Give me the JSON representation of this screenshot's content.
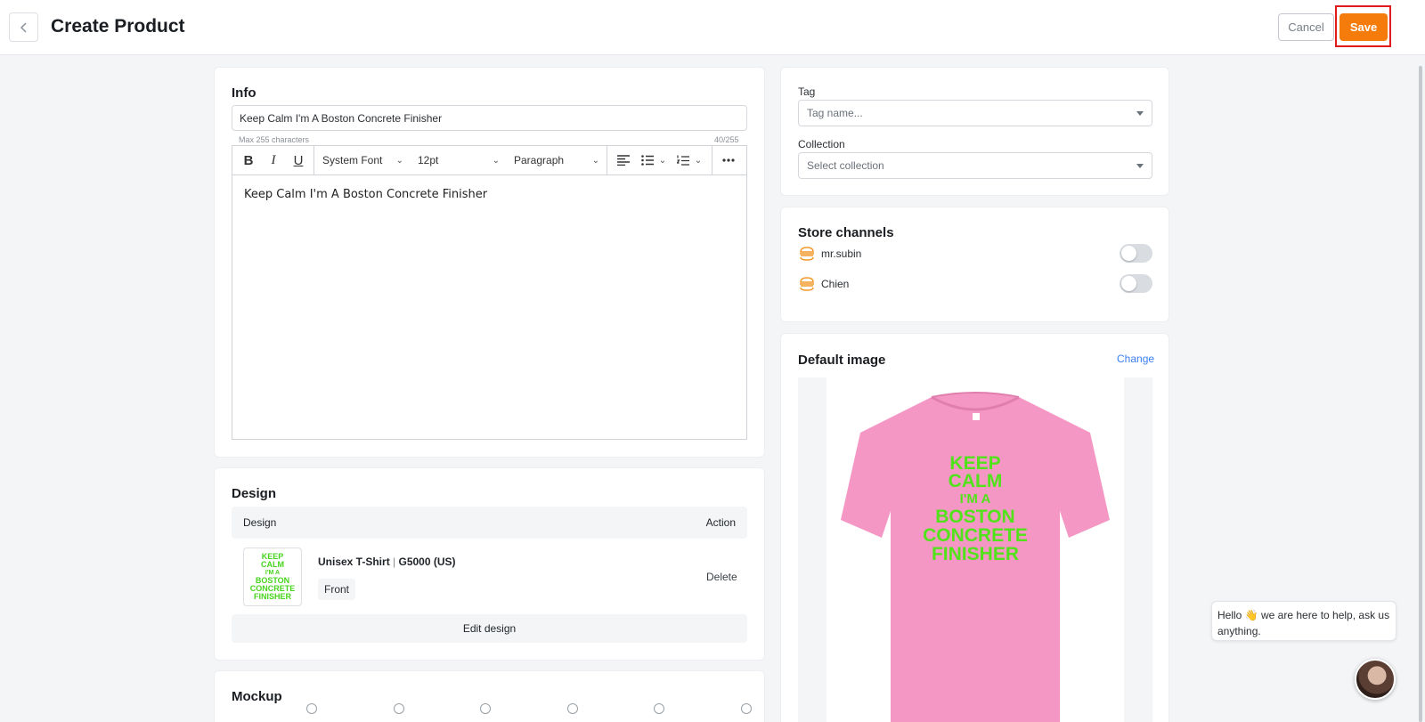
{
  "header": {
    "title": "Create Product",
    "cancel_label": "Cancel",
    "save_label": "Save"
  },
  "info": {
    "title": "Info",
    "product_name": "Keep Calm I'm A Boston Concrete Finisher",
    "max_note": "Max 255 characters",
    "char_count": "40/255",
    "toolbar": {
      "bold": "B",
      "italic": "I",
      "underline": "U",
      "font": "System Font",
      "size": "12pt",
      "block": "Paragraph"
    },
    "description": "Keep Calm I'm A Boston Concrete Finisher"
  },
  "design": {
    "title": "Design",
    "col_design": "Design",
    "col_action": "Action",
    "thumb_lines": [
      "KEEP",
      "CALM",
      "I'M A",
      "BOSTON",
      "CONCRETE",
      "FINISHER"
    ],
    "product_name": "Unisex T-Shirt",
    "product_sep": " | ",
    "product_code": "G5000 (US)",
    "side": "Front",
    "delete_label": "Delete",
    "edit_label": "Edit design"
  },
  "mockup": {
    "title": "Mockup"
  },
  "tag": {
    "label": "Tag",
    "placeholder": "Tag name..."
  },
  "collection": {
    "label": "Collection",
    "placeholder": "Select collection"
  },
  "store_channels": {
    "title": "Store channels",
    "items": [
      {
        "name": "mr.subin",
        "enabled": false
      },
      {
        "name": "Chien",
        "enabled": false
      }
    ]
  },
  "default_image": {
    "title": "Default image",
    "change_label": "Change",
    "shirt_color": "#f497c4",
    "print_color": "#52e21c",
    "shirt_lines": [
      "KEEP",
      "CALM",
      "I'M A",
      "BOSTON",
      "CONCRETE",
      "FINISHER"
    ]
  },
  "chat": {
    "message_start": "Hello",
    "emoji": "👋",
    "message_end": " we are here to help, ask us anything."
  },
  "colors": {
    "accent": "#f57c0a",
    "link": "#3b7ff5",
    "highlight_border": "#e01b1b"
  }
}
